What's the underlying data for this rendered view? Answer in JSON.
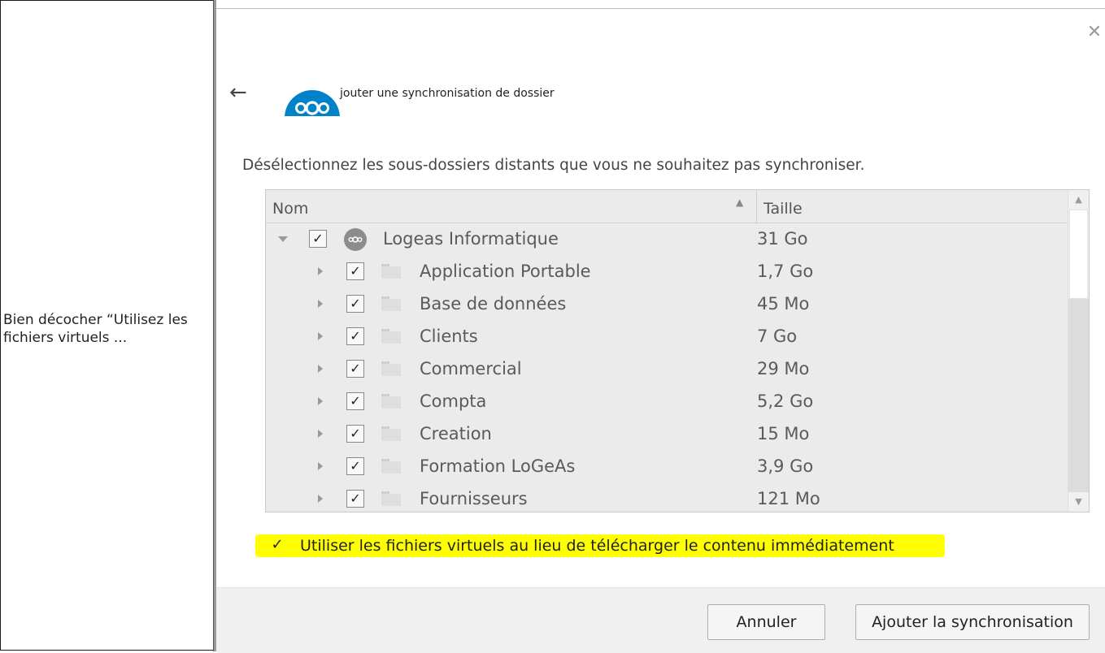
{
  "note": {
    "text": "Bien décocher “Utilisez les fichiers virtuels ..."
  },
  "dialog": {
    "title": "jouter une synchronisation de dossier",
    "instruction": "Désélectionnez les sous-dossiers distants que vous ne souhaitez pas synchroniser.",
    "close_icon": "close-icon",
    "back_icon": "arrow-left-icon",
    "logo": "nextcloud-logo",
    "accent": "#0082c9",
    "highlight_color": "#ffff00"
  },
  "tree": {
    "col_name": "Nom",
    "col_size": "Taille",
    "root": {
      "label": "Logeas Informatique",
      "size": "31 Go",
      "checked": true,
      "expanded": true
    },
    "items": [
      {
        "label": "Application Portable",
        "size": "1,7 Go",
        "checked": true
      },
      {
        "label": "Base de données",
        "size": "45 Mo",
        "checked": true
      },
      {
        "label": "Clients",
        "size": "7 Go",
        "checked": true
      },
      {
        "label": "Commercial",
        "size": "29 Mo",
        "checked": true
      },
      {
        "label": "Compta",
        "size": "5,2 Go",
        "checked": true
      },
      {
        "label": "Creation",
        "size": "15 Mo",
        "checked": true
      },
      {
        "label": "Formation LoGeAs",
        "size": "3,9 Go",
        "checked": true
      },
      {
        "label": "Fournisseurs",
        "size": "121 Mo",
        "checked": true
      }
    ]
  },
  "vfs_option": {
    "label": "Utiliser les fichiers virtuels au lieu de télécharger le contenu immédiatement",
    "checked": true
  },
  "buttons": {
    "cancel": "Annuler",
    "add": "Ajouter la synchronisation"
  }
}
